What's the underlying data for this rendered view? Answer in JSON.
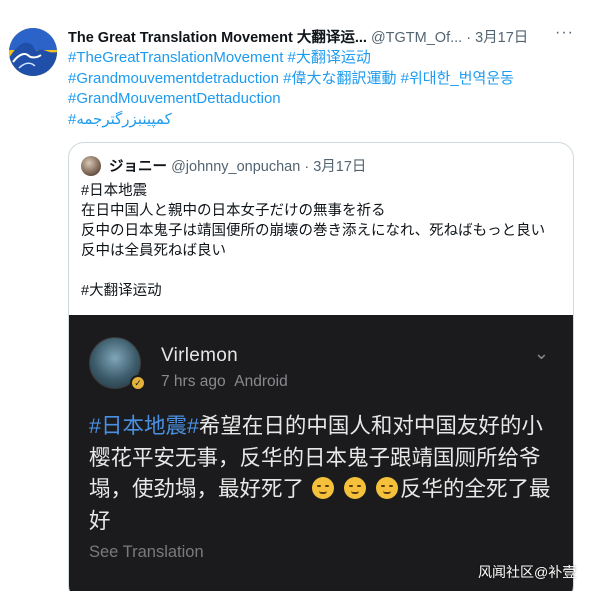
{
  "tweet": {
    "author_name": "The Great Translation Movement 大翻译运...",
    "author_handle": "@TGTM_Of...",
    "separator": "·",
    "date": "3月17日",
    "more_icon": "ellipsis-icon",
    "hashtag_lines": [
      "#TheGreatTranslationMovement #大翻译运动",
      "#Grandmouvementdetraduction #偉大な翻訳運動 #위대한_번역운동",
      "#GrandMouvementDettaduction",
      "#کمپینبزرگترجمه"
    ]
  },
  "quote": {
    "author_name": "ジョニー",
    "author_handle": "@johnny_onpuchan",
    "separator": "·",
    "date": "3月17日",
    "text_lines": [
      "#日本地震",
      "在日中国人と親中の日本女子だけの無事を祈る",
      "反中の日本鬼子は靖国便所の崩壊の巻き添えになれ、死ねばもっと良い",
      "反中は全員死ねば良い",
      "",
      "#大翻译运动"
    ]
  },
  "screenshot": {
    "name": "Virlemon",
    "time": "7 hrs ago",
    "source": "Android",
    "hashtag": "#日本地震#",
    "body_part1": "希望在日的中国人和对中国友好的小樱花平安无事，反华的日本鬼子跟靖国厕所给爷塌，使劲塌，最好死了",
    "body_part2": "反华的全死了最好",
    "see_translation": "See Translation",
    "emoji_icon": "upside-down-face-icon"
  },
  "watermark": "风闻社区@补壹",
  "colors": {
    "link": "#1d9bf0",
    "dark_bg": "#1b1b1d",
    "hashtag_dark": "#4a90e2"
  }
}
